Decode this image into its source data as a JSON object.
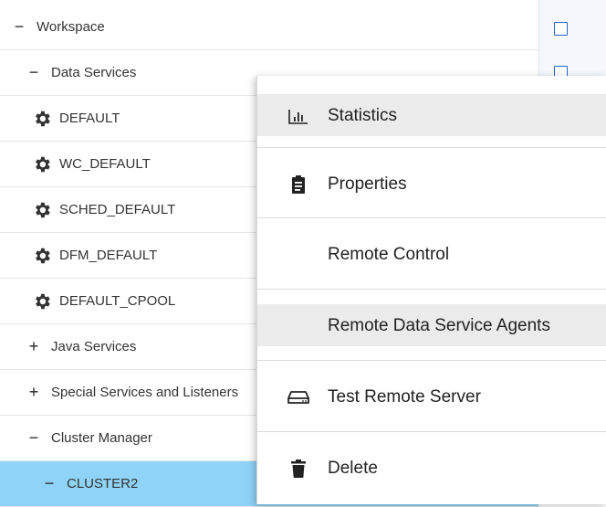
{
  "tree": {
    "rows": [
      {
        "toggle": "−",
        "label": "Workspace"
      },
      {
        "toggle": "−",
        "label": "Data Services"
      },
      {
        "icon": "gear-icon",
        "label": "DEFAULT"
      },
      {
        "icon": "gear-icon",
        "label": "WC_DEFAULT"
      },
      {
        "icon": "gear-icon",
        "label": "SCHED_DEFAULT"
      },
      {
        "icon": "gear-icon",
        "label": "DFM_DEFAULT"
      },
      {
        "icon": "gear-icon",
        "label": "DEFAULT_CPOOL"
      },
      {
        "toggle": "+",
        "label": "Java Services"
      },
      {
        "toggle": "+",
        "label": "Special Services and Listeners"
      },
      {
        "toggle": "−",
        "label": "Cluster Manager"
      },
      {
        "toggle": "−",
        "label": "CLUSTER2",
        "selected": true
      }
    ]
  },
  "context_menu": {
    "items": [
      {
        "icon": "bar-chart-icon",
        "label": "Statistics",
        "highlighted": true
      },
      {
        "icon": "clipboard-icon",
        "label": "Properties"
      },
      {
        "icon": "",
        "label": "Remote Control"
      },
      {
        "icon": "",
        "label": "Remote Data Service Agents",
        "highlighted": true
      },
      {
        "icon": "hard-drive-icon",
        "label": "Test Remote Server"
      },
      {
        "icon": "trash-icon",
        "label": "Delete"
      }
    ]
  },
  "colors": {
    "selected_row": "#8fd3f8",
    "checkbox_border": "#2a63c7",
    "menu_highlight": "#ebebeb"
  }
}
